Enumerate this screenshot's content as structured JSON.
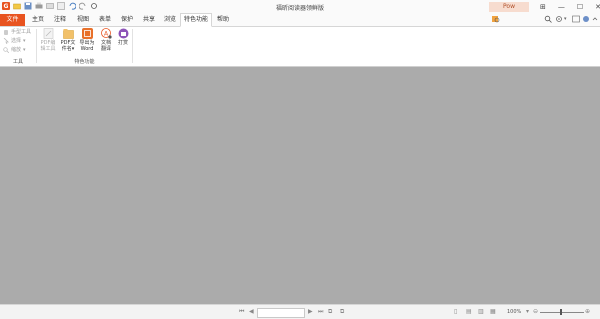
{
  "window": {
    "title": "福昕阅读器领鲜版",
    "pro_label": "Pow"
  },
  "tabs": {
    "file": "文件",
    "home": "主页",
    "comment": "注释",
    "view": "视图",
    "form": "表单",
    "protect": "保护",
    "share": "共享",
    "browse": "浏览",
    "features": "特色功能",
    "help": "帮助"
  },
  "search": {
    "placeholder": "查找"
  },
  "ribbon": {
    "tools_group": {
      "label": "工具",
      "hand": "手型工具",
      "select": "选择",
      "zoom": "缩放"
    },
    "features_group": {
      "label": "特色功能",
      "pdf_maker": [
        "PDF编",
        "辑工具"
      ],
      "pdf_to_word": [
        "PDF文",
        "件名"
      ],
      "export_word": [
        "导出为",
        "Word"
      ],
      "translate": [
        "文档",
        "翻译"
      ],
      "print": [
        "打赏"
      ]
    }
  },
  "status": {
    "zoom": "100%"
  },
  "colors": {
    "accent": "#e8531f",
    "canvas": "#ababab"
  }
}
